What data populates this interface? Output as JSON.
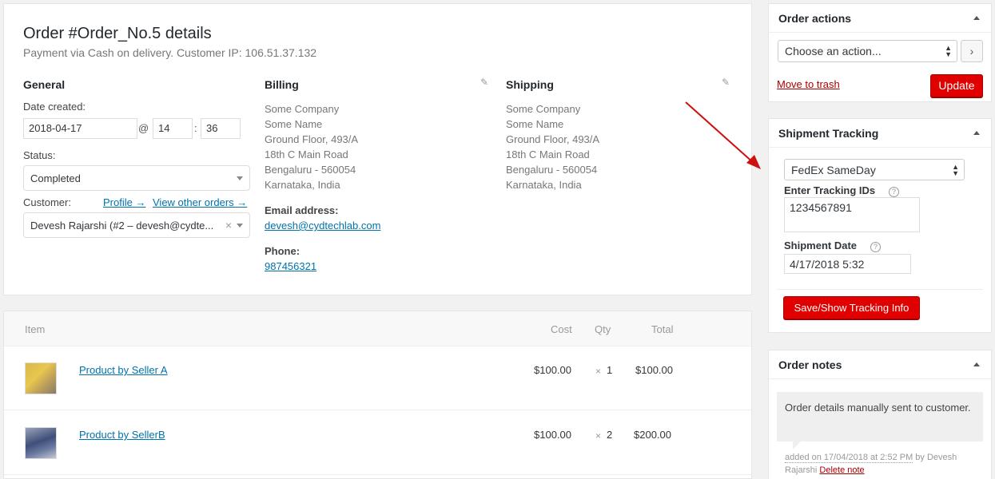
{
  "order": {
    "title": "Order #Order_No.5 details",
    "subtitle": "Payment via Cash on delivery. Customer IP: 106.51.37.132"
  },
  "general": {
    "heading": "General",
    "date_label": "Date created:",
    "date_value": "2018-04-17",
    "at": "@",
    "hour": "14",
    "colon": ":",
    "minute": "36",
    "status_label": "Status:",
    "status_value": "Completed",
    "customer_label": "Customer:",
    "profile_link": "Profile →",
    "view_orders_link": "View other orders →",
    "customer_value": "Devesh Rajarshi (#2 – devesh@cydte...",
    "clear": "×"
  },
  "billing": {
    "heading": "Billing",
    "lines": [
      "Some Company",
      "Some Name",
      "Ground Floor, 493/A",
      "18th C Main Road",
      "Bengaluru - 560054",
      "Karnataka, India"
    ],
    "email_label": "Email address:",
    "email": "devesh@cydtechlab.com",
    "phone_label": "Phone:",
    "phone": "987456321"
  },
  "shipping": {
    "heading": "Shipping",
    "lines": [
      "Some Company",
      "Some Name",
      "Ground Floor, 493/A",
      "18th C Main Road",
      "Bengaluru - 560054",
      "Karnataka, India"
    ]
  },
  "items": {
    "headers": {
      "item": "Item",
      "cost": "Cost",
      "qty": "Qty",
      "total": "Total"
    },
    "rows": [
      {
        "name": "Product by Seller A",
        "cost": "$100.00",
        "times": "×",
        "qty": "1",
        "total": "$100.00"
      },
      {
        "name": "Product by SellerB",
        "cost": "$100.00",
        "times": "×",
        "qty": "2",
        "total": "$200.00"
      }
    ]
  },
  "order_actions": {
    "title": "Order actions",
    "select_value": "Choose an action...",
    "go": "›",
    "trash": "Move to trash",
    "update": "Update"
  },
  "shipment": {
    "title": "Shipment Tracking",
    "provider": "FedEx SameDay",
    "tracking_label": "Enter Tracking IDs",
    "tracking_value": "1234567891",
    "date_label": "Shipment Date",
    "date_value": "4/17/2018 5:32",
    "button": "Save/Show Tracking Info",
    "help": "?"
  },
  "notes": {
    "title": "Order notes",
    "note_text": "Order details manually sent to customer.",
    "meta_added": "added on 17/04/2018 at 2:52 PM",
    "meta_by": " by Devesh Rajarshi ",
    "delete": "Delete note"
  },
  "colors": {
    "accent_red": "#e00000",
    "link": "#0073aa",
    "arrow": "#cc1111"
  }
}
